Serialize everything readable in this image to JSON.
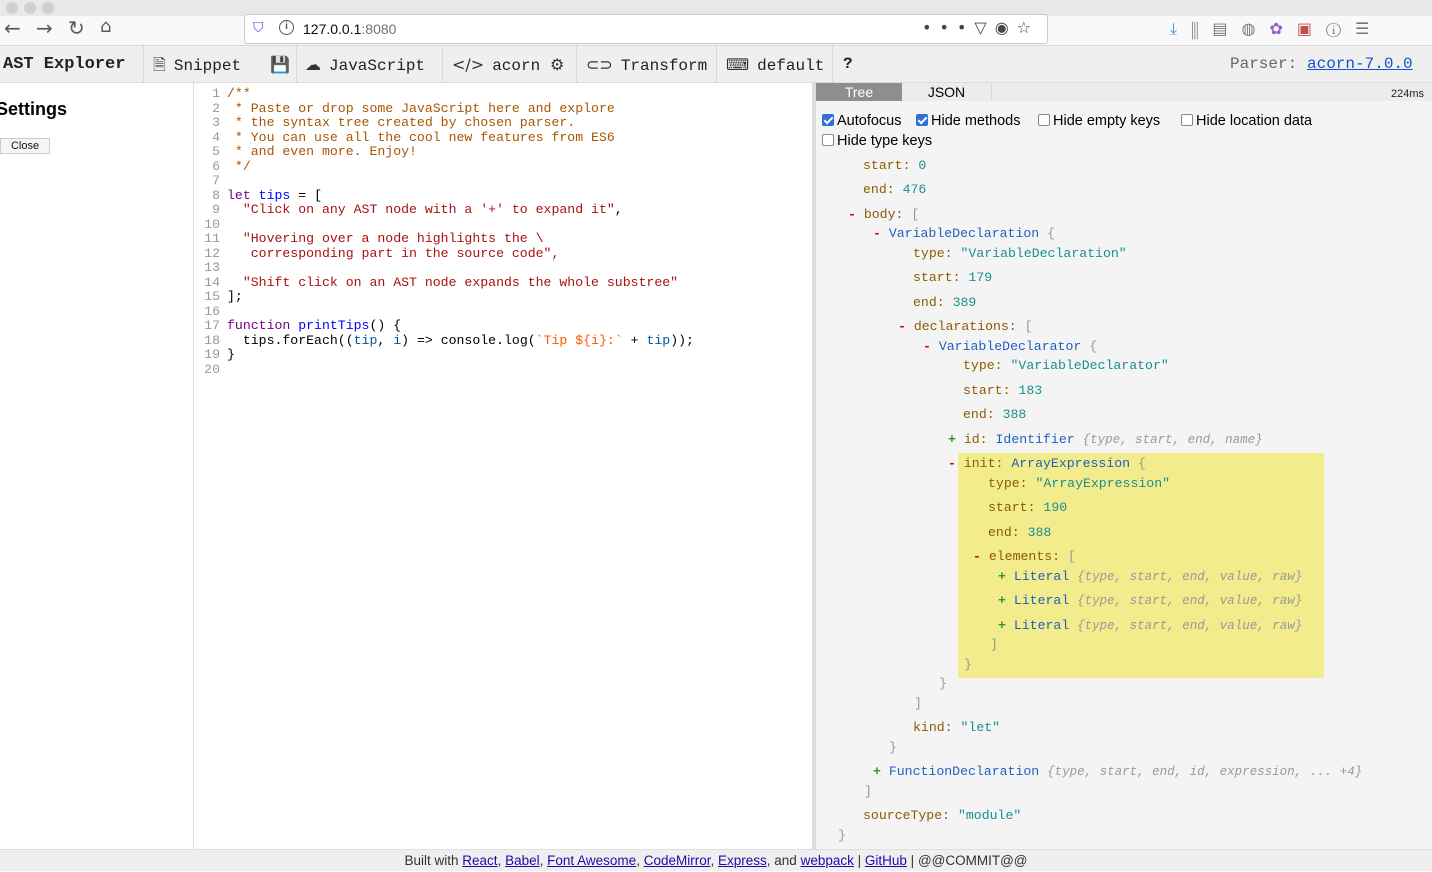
{
  "browser": {
    "url_host": "127.0.0.1",
    "url_port": ":8080"
  },
  "toolbar": {
    "app_title": "AST Explorer",
    "snippet_label": "Snippet",
    "language_label": "JavaScript",
    "parser_name_label": "acorn",
    "transform_label": "Transform",
    "keymap_label": "default",
    "help_label": "?",
    "parser_prefix": "Parser:",
    "parser_version": "acorn-7.0.0"
  },
  "settings": {
    "title": "Settings",
    "close_label": "Close"
  },
  "editor": {
    "lines": [
      "/**",
      " * Paste or drop some JavaScript here and explore",
      " * the syntax tree created by chosen parser.",
      " * You can use all the cool new features from ES6",
      " * and even more. Enjoy!",
      " */",
      "",
      "let tips = [",
      "  \"Click on any AST node with a '+' to expand it\",",
      "",
      "  \"Hovering over a node highlights the \\",
      "   corresponding part in the source code\",",
      "",
      "  \"Shift click on an AST node expands the whole substree\"",
      "];",
      "",
      "function printTips() {",
      "  tips.forEach((tip, i) => console.log(`Tip ${i}:` + tip));",
      "}",
      ""
    ]
  },
  "ast": {
    "tab_tree": "Tree",
    "tab_json": "JSON",
    "parse_time": "224ms",
    "options": {
      "autofocus": "Autofocus",
      "hide_methods": "Hide methods",
      "hide_empty_keys": "Hide empty keys",
      "hide_location_data": "Hide location data",
      "hide_type_keys": "Hide type keys"
    },
    "tree": {
      "start_key": "start:",
      "start_val": "0",
      "end_key": "end:",
      "end_val": "476",
      "body_key": "body:",
      "vardecl_name": "VariableDeclaration",
      "vardecl_type_key": "type:",
      "vardecl_type_val": "\"VariableDeclaration\"",
      "vardecl_start_key": "start:",
      "vardecl_start_val": "179",
      "vardecl_end_key": "end:",
      "vardecl_end_val": "389",
      "declarations_key": "declarations:",
      "declarator_name": "VariableDeclarator",
      "declarator_type_key": "type:",
      "declarator_type_val": "\"VariableDeclarator\"",
      "declarator_start_key": "start:",
      "declarator_start_val": "183",
      "declarator_end_key": "end:",
      "declarator_end_val": "388",
      "id_key": "id:",
      "id_type": "Identifier",
      "id_summary": "{type, start, end, name}",
      "init_key": "init:",
      "init_type": "ArrayExpression",
      "init_type_key": "type:",
      "init_type_val": "\"ArrayExpression\"",
      "init_start_key": "start:",
      "init_start_val": "190",
      "init_end_key": "end:",
      "init_end_val": "388",
      "elements_key": "elements:",
      "literal_name": "Literal",
      "literal_summary": "{type, start, end, value, raw}",
      "kind_key": "kind:",
      "kind_val": "\"let\"",
      "funcdecl_name": "FunctionDeclaration",
      "funcdecl_summary": "{type, start, end, id, expression, ... +4}",
      "sourcetype_key": "sourceType:",
      "sourcetype_val": "\"module\""
    }
  },
  "footer": {
    "built_with": "Built with",
    "react": "React",
    "babel": "Babel",
    "font_awesome": "Font Awesome",
    "codemirror": "CodeMirror",
    "express": "Express",
    "and": ", and",
    "webpack": "webpack",
    "github": "GitHub",
    "commit": "@@COMMIT@@"
  }
}
